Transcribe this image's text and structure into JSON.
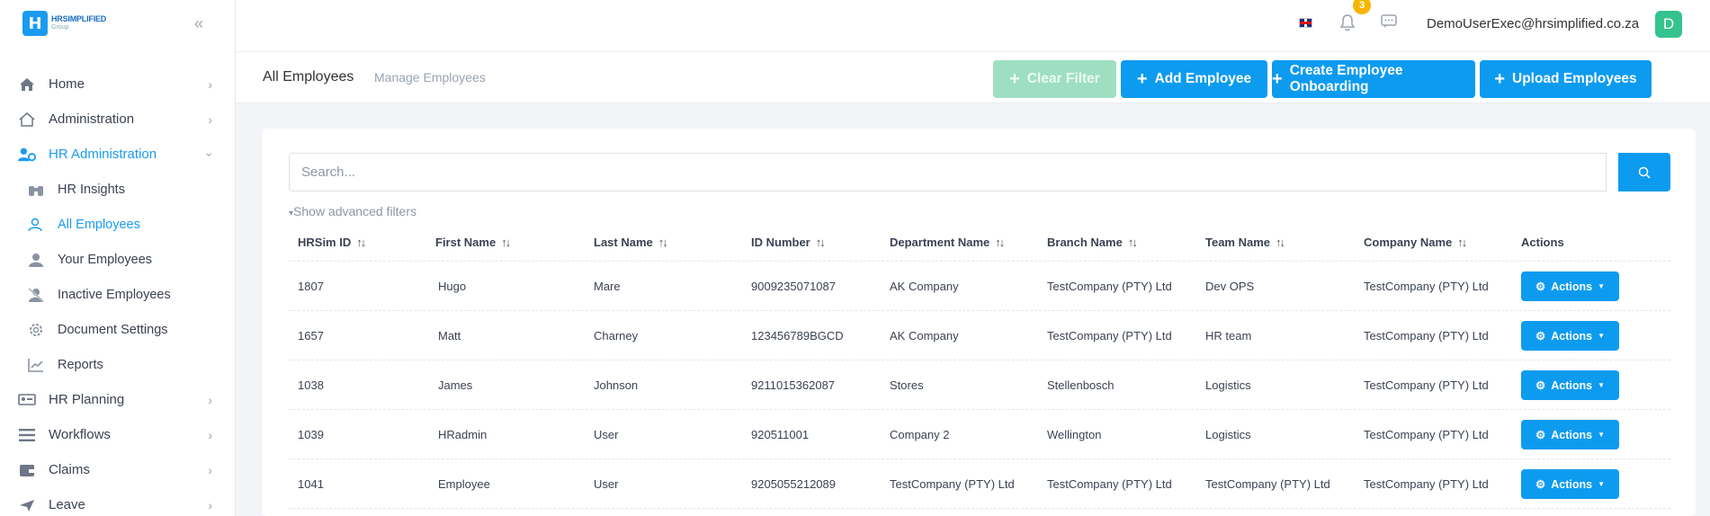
{
  "logo": {
    "mark": "H",
    "line1": "HRSIMPLIFIED",
    "line2": "Group"
  },
  "sidebar": {
    "items": [
      {
        "label": "Home",
        "icon": "home-icon"
      },
      {
        "label": "Administration",
        "icon": "admin-home-icon"
      },
      {
        "label": "HR Administration",
        "icon": "users-cog-icon"
      },
      {
        "label": "HR Insights",
        "icon": "binoculars-icon"
      },
      {
        "label": "All Employees",
        "icon": "users-outline-icon"
      },
      {
        "label": "Your Employees",
        "icon": "user-icon"
      },
      {
        "label": "Inactive Employees",
        "icon": "user-slash-icon"
      },
      {
        "label": "Document Settings",
        "icon": "gear-icon"
      },
      {
        "label": "Reports",
        "icon": "chart-line-icon"
      },
      {
        "label": "HR Planning",
        "icon": "planning-icon"
      },
      {
        "label": "Workflows",
        "icon": "list-icon"
      },
      {
        "label": "Claims",
        "icon": "wallet-icon"
      },
      {
        "label": "Leave",
        "icon": "plane-icon"
      }
    ]
  },
  "topbar": {
    "notification_count": "3",
    "user_email": "DemoUserExec@hrsimplified.co.za",
    "avatar_letter": "D"
  },
  "subheader": {
    "title": "All Employees",
    "subtitle": "Manage Employees",
    "buttons": {
      "clear_filter": "Clear Filter",
      "add_employee": "Add Employee",
      "create_onboarding": "Create Employee Onboarding",
      "upload_employees": "Upload Employees"
    }
  },
  "search": {
    "placeholder": "Search...",
    "advanced_filters": "Show advanced filters"
  },
  "table": {
    "headers": [
      "HRSim ID",
      "First Name",
      "Last Name",
      "ID Number",
      "Department Name",
      "Branch Name",
      "Team Name",
      "Company Name",
      "Actions"
    ],
    "rows": [
      [
        "1807",
        "Hugo",
        "Mare",
        "9009235071087",
        "AK Company",
        "TestCompany (PTY) Ltd",
        "Dev OPS",
        "TestCompany (PTY) Ltd"
      ],
      [
        "1657",
        "Matt",
        "Charney",
        "123456789BGCD",
        "AK Company",
        "TestCompany (PTY) Ltd",
        "HR team",
        "TestCompany (PTY) Ltd"
      ],
      [
        "1038",
        "James",
        "Johnson",
        "9211015362087",
        "Stores",
        "Stellenbosch",
        "Logistics",
        "TestCompany (PTY) Ltd"
      ],
      [
        "1039",
        "HRadmin",
        "User",
        "920511001",
        "Company 2",
        "Wellington",
        "Logistics",
        "TestCompany (PTY) Ltd"
      ],
      [
        "1041",
        "Employee",
        "User",
        "9205055212089",
        "TestCompany (PTY) Ltd",
        "TestCompany (PTY) Ltd",
        "TestCompany (PTY) Ltd",
        "TestCompany (PTY) Ltd"
      ]
    ],
    "action_label": "Actions"
  },
  "colors": {
    "primary": "#0d9bf0",
    "active_nav": "#1a9bf0",
    "disabled_btn": "#9fdfc1",
    "avatar": "#34c38f",
    "badge": "#f7b500"
  }
}
